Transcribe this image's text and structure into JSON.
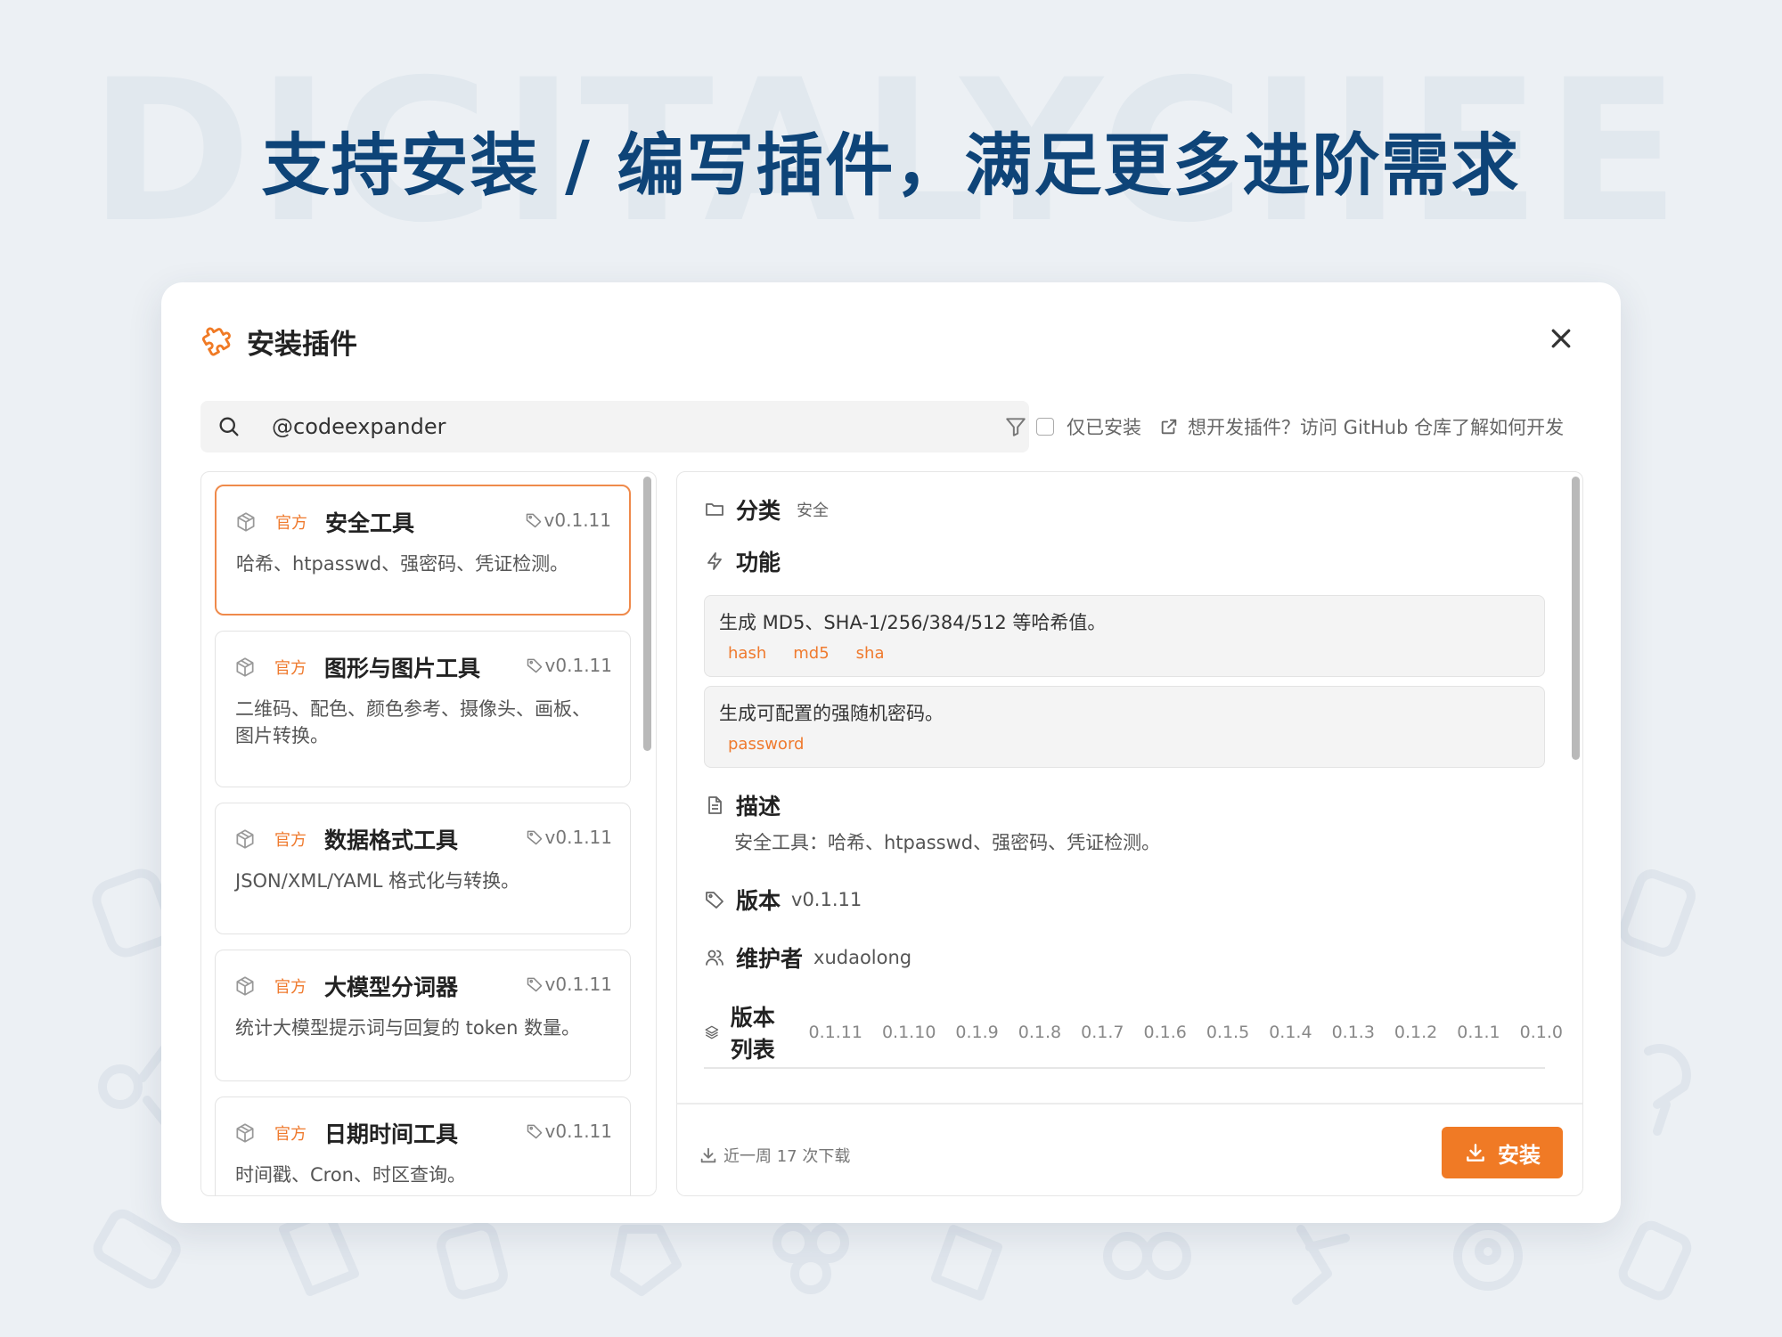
{
  "watermark": "DIGITALYCIIEE",
  "headline": "支持安装 / 编写插件，满足更多进阶需求",
  "dialog": {
    "title": "安装插件",
    "title_icon": "puzzle-icon",
    "close_icon": "close-icon"
  },
  "search": {
    "value": "@codeexpander",
    "placeholder": ""
  },
  "toolbar": {
    "filter_icon": "filter-icon",
    "installed_only_label": "仅已安装",
    "installed_only_checked": false,
    "dev_link": "想开发插件？访问 GitHub 仓库了解如何开发"
  },
  "plugins": [
    {
      "badge": "官方",
      "name": "安全工具",
      "version": "v0.1.11",
      "desc": "哈希、htpasswd、强密码、凭证检测。"
    },
    {
      "badge": "官方",
      "name": "图形与图片工具",
      "version": "v0.1.11",
      "desc": "二维码、配色、颜色参考、摄像头、画板、图片转换。"
    },
    {
      "badge": "官方",
      "name": "数据格式工具",
      "version": "v0.1.11",
      "desc": "JSON/XML/YAML 格式化与转换。"
    },
    {
      "badge": "官方",
      "name": "大模型分词器",
      "version": "v0.1.11",
      "desc": "统计大模型提示词与回复的 token 数量。"
    },
    {
      "badge": "官方",
      "name": "日期时间工具",
      "version": "v0.1.11",
      "desc": "时间戳、Cron、时区查询。"
    }
  ],
  "detail": {
    "category_label": "分类",
    "category_value": "安全",
    "features_label": "功能",
    "features": [
      {
        "text": "生成 MD5、SHA-1/256/384/512 等哈希值。",
        "tags": [
          "hash",
          "md5",
          "sha"
        ]
      },
      {
        "text": "生成可配置的强随机密码。",
        "tags": [
          "password"
        ]
      }
    ],
    "description_label": "描述",
    "description_value": "安全工具：哈希、htpasswd、强密码、凭证检测。",
    "version_label": "版本",
    "version_value": "v0.1.11",
    "maintainer_label": "维护者",
    "maintainer_value": "xudaolong",
    "versions_label": "版本列表",
    "versions": [
      "0.1.11",
      "0.1.10",
      "0.1.9",
      "0.1.8",
      "0.1.7",
      "0.1.6",
      "0.1.5",
      "0.1.4",
      "0.1.3",
      "0.1.2",
      "0.1.1",
      "0.1.0"
    ],
    "downloads": "近一周 17 次下载",
    "install_label": "安装"
  },
  "colors": {
    "accent": "#f07a25",
    "headline": "#0e4478",
    "background": "#ecf0f4"
  }
}
